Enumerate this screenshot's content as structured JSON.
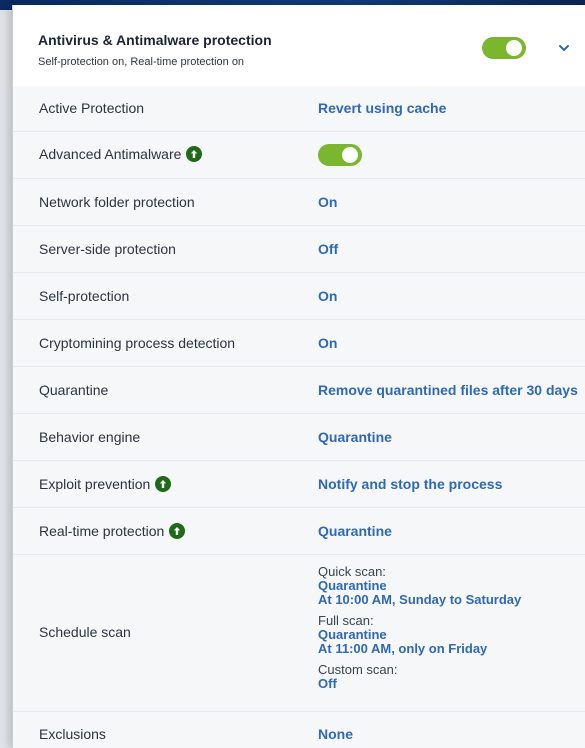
{
  "header": {
    "title": "Antivirus & Antimalware protection",
    "subtitle": "Self-protection on, Real-time protection on",
    "toggle_state": "on",
    "chevron_icon": "chevron-down-icon"
  },
  "settings": {
    "items": [
      {
        "label": "Active Protection",
        "value": "Revert using cache"
      },
      {
        "label": "Advanced Antimalware",
        "value": "on"
      },
      {
        "label": "Network folder protection",
        "value": "On"
      },
      {
        "label": "Server-side protection",
        "value": "Off"
      },
      {
        "label": "Self-protection",
        "value": "On"
      },
      {
        "label": "Cryptomining process detection",
        "value": "On"
      },
      {
        "label": "Quarantine",
        "value": "Remove quarantined files after 30 days"
      },
      {
        "label": "Behavior engine",
        "value": "Quarantine"
      },
      {
        "label": "Exploit prevention",
        "value": "Notify and stop the process"
      },
      {
        "label": "Real-time protection",
        "value": "Quarantine"
      },
      {
        "label": "Schedule scan",
        "quick_scan_label": "Quick scan:",
        "quick_scan_value": "Quarantine",
        "quick_scan_schedule": "At 10:00 AM, Sunday to Saturday",
        "full_scan_label": "Full scan:",
        "full_scan_value": "Quarantine",
        "full_scan_schedule": "At 11:00 AM, only on Friday",
        "custom_scan_label": "Custom scan:",
        "custom_scan_value": "Off"
      },
      {
        "label": "Exclusions",
        "value": "None"
      }
    ]
  },
  "colors": {
    "accent": "#2f68b3",
    "toggle_green": "#7ab72e",
    "badge_green": "#1e6b17"
  }
}
